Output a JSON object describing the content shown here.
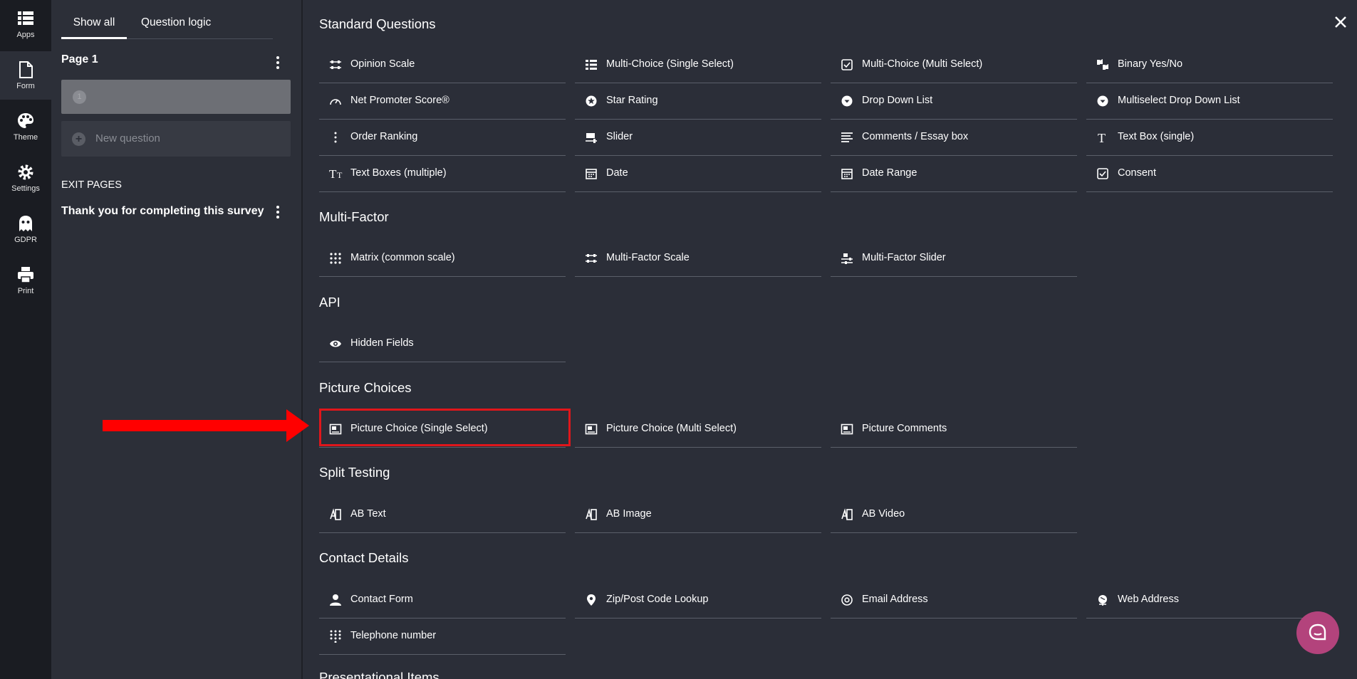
{
  "rail": [
    {
      "label": "Apps",
      "icon": "apps-icon"
    },
    {
      "label": "Form",
      "icon": "form-icon"
    },
    {
      "label": "Theme",
      "icon": "theme-icon"
    },
    {
      "label": "Settings",
      "icon": "gear-icon"
    },
    {
      "label": "GDPR",
      "icon": "gdpr-ghost-icon"
    },
    {
      "label": "Print",
      "icon": "printer-icon"
    }
  ],
  "panel": {
    "tabs": [
      "Show all",
      "Question logic"
    ],
    "active_tab": "Show all",
    "page_title": "Page 1",
    "question_number": "1",
    "new_question": "New question",
    "exit_pages_label": "EXIT PAGES",
    "exit_page": "Thank you for completing this survey"
  },
  "sections": [
    {
      "title": "Standard Questions",
      "items": [
        {
          "label": "Opinion Scale",
          "icon": "scale-icon"
        },
        {
          "label": "Multi-Choice (Single Select)",
          "icon": "list-icon"
        },
        {
          "label": "Multi-Choice (Multi Select)",
          "icon": "checkbox-icon"
        },
        {
          "label": "Binary Yes/No",
          "icon": "thumbs-icon"
        },
        {
          "label": "Net Promoter Score®",
          "icon": "gauge-icon"
        },
        {
          "label": "Star Rating",
          "icon": "star-icon"
        },
        {
          "label": "Drop Down List",
          "icon": "dropdown-icon"
        },
        {
          "label": "Multiselect Drop Down List",
          "icon": "dropdown-icon"
        },
        {
          "label": "Order Ranking",
          "icon": "ranking-icon"
        },
        {
          "label": "Slider",
          "icon": "slider-icon"
        },
        {
          "label": "Comments / Essay box",
          "icon": "paragraph-icon"
        },
        {
          "label": "Text Box (single)",
          "icon": "text-icon"
        },
        {
          "label": "Text Boxes (multiple)",
          "icon": "text-multi-icon"
        },
        {
          "label": "Date",
          "icon": "calendar-icon"
        },
        {
          "label": "Date Range",
          "icon": "calendar-icon"
        },
        {
          "label": "Consent",
          "icon": "checkbox-icon"
        }
      ]
    },
    {
      "title": "Multi-Factor",
      "items": [
        {
          "label": "Matrix (common scale)",
          "icon": "grid-icon"
        },
        {
          "label": "Multi-Factor Scale",
          "icon": "scale-icon"
        },
        {
          "label": "Multi-Factor Slider",
          "icon": "slider-icon"
        }
      ]
    },
    {
      "title": "API",
      "items": [
        {
          "label": "Hidden Fields",
          "icon": "eye-icon"
        }
      ]
    },
    {
      "title": "Picture Choices",
      "items": [
        {
          "label": "Picture Choice (Single Select)",
          "icon": "picture-icon"
        },
        {
          "label": "Picture Choice (Multi Select)",
          "icon": "picture-icon"
        },
        {
          "label": "Picture Comments",
          "icon": "picture-icon"
        }
      ]
    },
    {
      "title": "Split Testing",
      "items": [
        {
          "label": "AB Text",
          "icon": "ab-test-icon"
        },
        {
          "label": "AB Image",
          "icon": "ab-test-icon"
        },
        {
          "label": "AB Video",
          "icon": "ab-test-icon"
        }
      ]
    },
    {
      "title": "Contact Details",
      "items": [
        {
          "label": "Contact Form",
          "icon": "person-icon"
        },
        {
          "label": "Zip/Post Code Lookup",
          "icon": "pin-icon"
        },
        {
          "label": "Email Address",
          "icon": "at-icon"
        },
        {
          "label": "Web Address",
          "icon": "globe-icon"
        },
        {
          "label": "Telephone number",
          "icon": "keypad-icon"
        }
      ]
    },
    {
      "title": "Presentational Items",
      "items": []
    }
  ],
  "highlighted_item": "Picture Choice (Single Select)",
  "colors": {
    "background": "#2b2e38",
    "rail": "#1a1c22",
    "panel": "#2c2f38",
    "highlight": "#e0161b",
    "chat": "#b3437c"
  }
}
